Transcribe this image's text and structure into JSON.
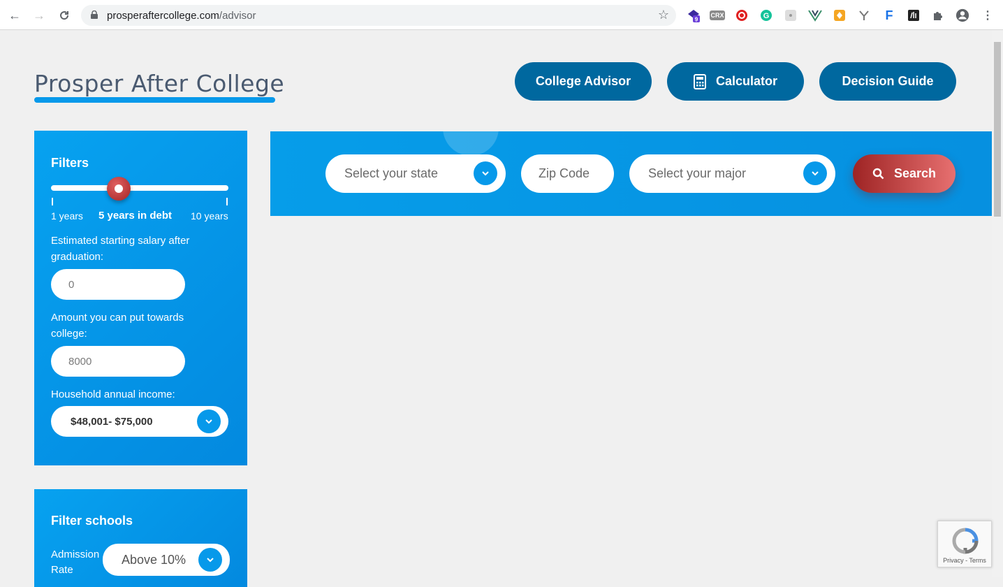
{
  "browser": {
    "url_domain": "prosperaftercollege.com",
    "url_path": "/advisor",
    "extension_badge": "9",
    "extension_crx": "CRX"
  },
  "header": {
    "logo": "Prosper After College",
    "nav": {
      "college_advisor": "College Advisor",
      "calculator": "Calculator",
      "decision_guide": "Decision Guide"
    }
  },
  "filters": {
    "title": "Filters",
    "debt_slider": {
      "min_label": "1 years",
      "current_label": "5 years in debt",
      "max_label": "10 years",
      "min": 1,
      "max": 10,
      "value": 5
    },
    "salary_label": "Estimated starting salary after graduation:",
    "salary_value": "0",
    "college_amount_label": "Amount you can put towards college:",
    "college_amount_value": "8000",
    "income_label": "Household annual income:",
    "income_value": "$48,001- $75,000"
  },
  "filter_schools": {
    "title": "Filter schools",
    "admission_label": "Admission Rate",
    "admission_value": "Above 10%"
  },
  "search": {
    "state_placeholder": "Select your state",
    "zip_placeholder": "Zip Code",
    "major_placeholder": "Select your major",
    "button": "Search"
  },
  "recaptcha": {
    "terms": "Privacy - Terms"
  },
  "colors": {
    "primary_blue": "#0799ea",
    "nav_button": "#00689f",
    "search_button": "#b83a3a"
  }
}
